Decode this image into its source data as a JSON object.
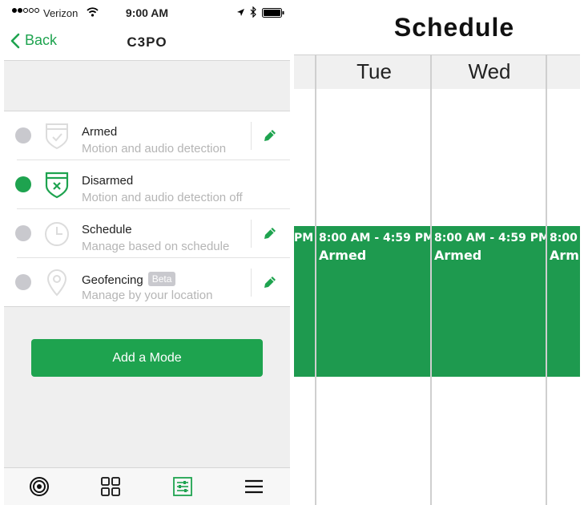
{
  "status_bar": {
    "carrier": "Verizon",
    "time": "9:00 AM"
  },
  "nav": {
    "back_label": "Back",
    "title": "C3PO"
  },
  "modes": [
    {
      "title": "Armed",
      "subtitle": "Motion and audio detection",
      "selected": false,
      "editable": true,
      "icon": "shield-check-icon"
    },
    {
      "title": "Disarmed",
      "subtitle": "Motion and audio detection off",
      "selected": true,
      "editable": false,
      "icon": "shield-x-icon"
    },
    {
      "title": "Schedule",
      "subtitle": "Manage based on schedule",
      "selected": false,
      "editable": true,
      "icon": "clock-icon"
    },
    {
      "title": "Geofencing",
      "subtitle": "Manage by your location",
      "selected": false,
      "editable": true,
      "icon": "location-pin-icon",
      "badge": "Beta"
    }
  ],
  "add_mode_label": "Add a Mode",
  "tab_bar": [
    {
      "icon": "camera-icon",
      "active": false
    },
    {
      "icon": "grid-icon",
      "active": false
    },
    {
      "icon": "sliders-icon",
      "active": true
    },
    {
      "icon": "menu-icon",
      "active": false
    }
  ],
  "schedule": {
    "title": "Schedule",
    "days": [
      "Tue",
      "Wed"
    ],
    "block_time": "8:00 AM - 4:59 PM",
    "block_time_partial_left": "PM",
    "block_time_partial_right": "8:00",
    "block_mode": "Armed",
    "block_mode_partial_right": "Arm"
  },
  "colors": {
    "accent": "#1ea34f",
    "schedule_block": "#1e9a4f",
    "inactive_radio": "#c9c9ce"
  }
}
